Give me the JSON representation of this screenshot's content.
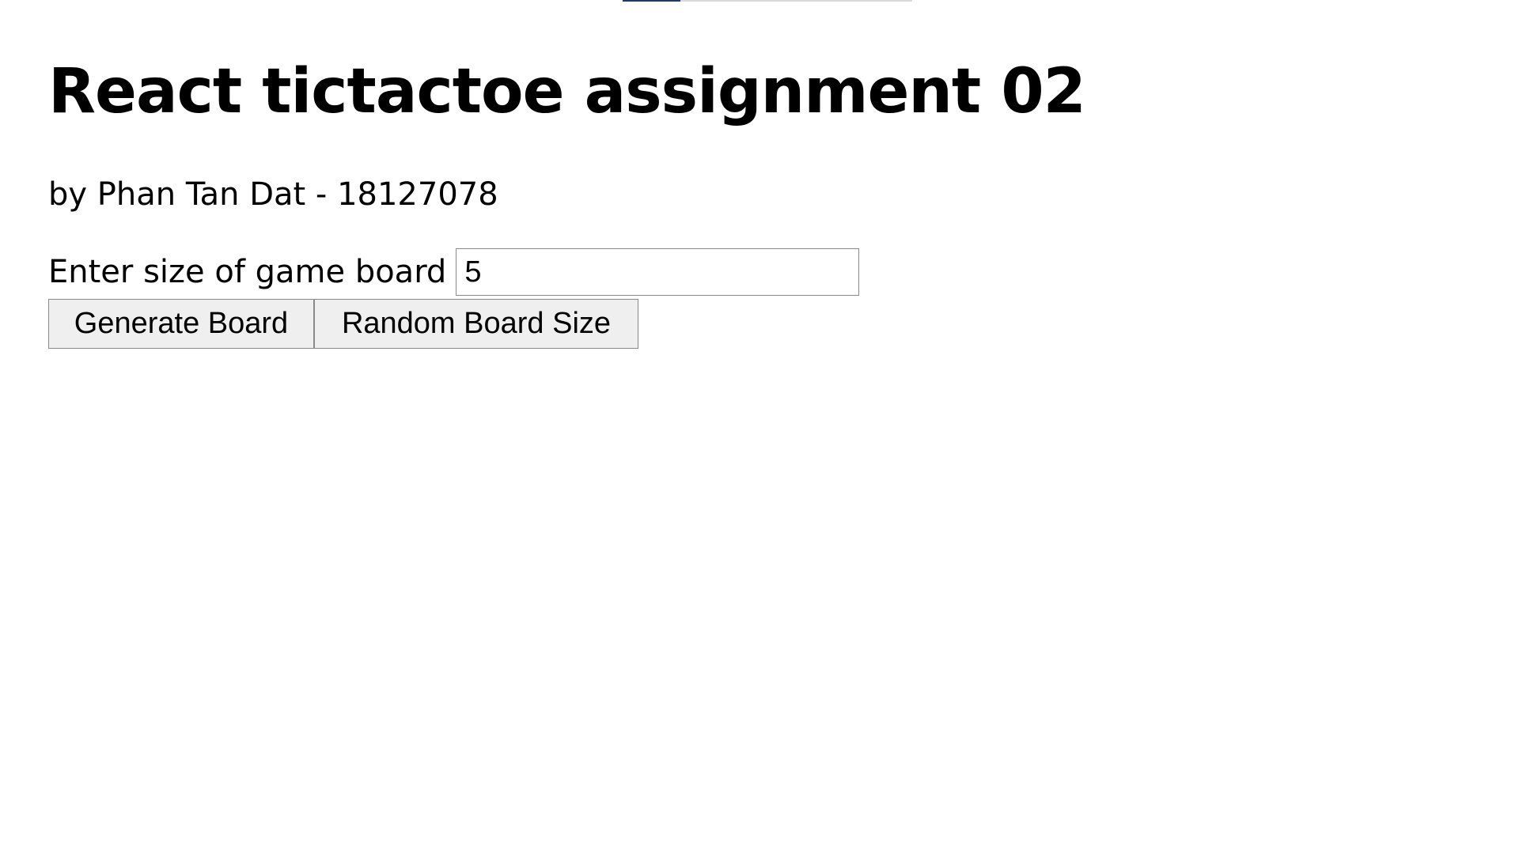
{
  "loading_bar": {
    "progress_fraction": 0.2,
    "fill_color": "#1f3b63",
    "track_color": "#d9d9d9"
  },
  "header": {
    "title": "React tictactoe assignment 02",
    "author": "by Phan Tan Dat - 18127078"
  },
  "form": {
    "size_label": "Enter size of game board",
    "size_value": "5",
    "generate_label": "Generate Board",
    "random_label": "Random Board Size"
  }
}
